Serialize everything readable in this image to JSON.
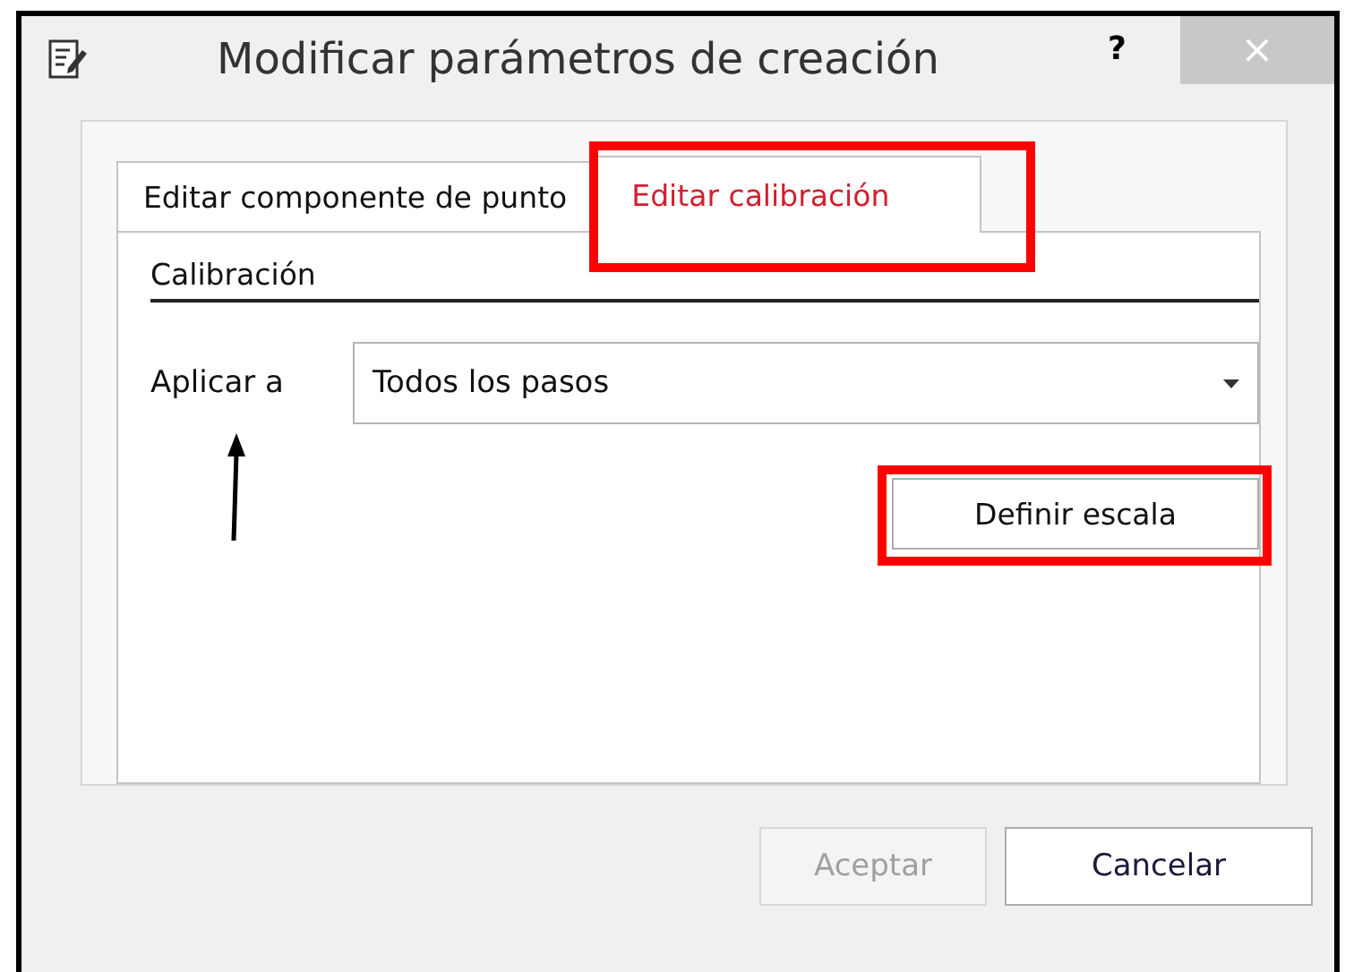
{
  "window": {
    "title": "Modificar parámetros de creación",
    "help": "?",
    "close": "×"
  },
  "tabs": [
    {
      "label": "Editar componente de punto",
      "selected": false,
      "highlighted": false
    },
    {
      "label": "Editar calibración",
      "selected": true,
      "highlighted": true
    }
  ],
  "section": {
    "title": "Calibración"
  },
  "apply_to": {
    "label": "Aplicar a",
    "value": "Todos los pasos",
    "pointer_arrow": true
  },
  "scale_button": {
    "label": "Definir escala",
    "highlighted": true
  },
  "buttons": [
    {
      "label": "Aceptar",
      "disabled": true
    },
    {
      "label": "Cancelar",
      "disabled": false
    }
  ]
}
